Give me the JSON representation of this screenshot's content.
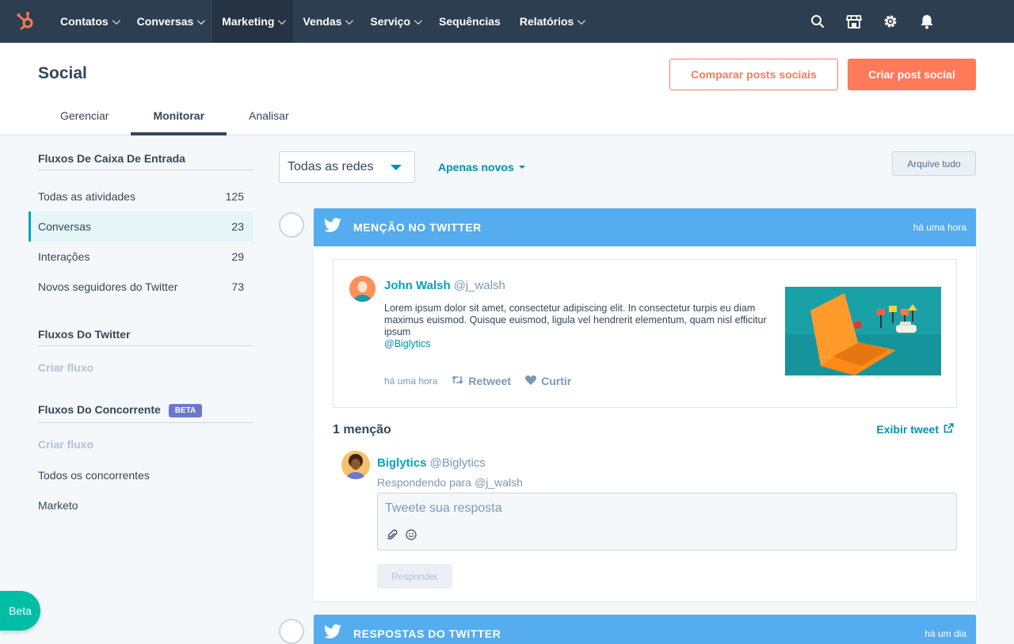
{
  "nav": {
    "items": [
      {
        "label": "Contatos",
        "caret": true
      },
      {
        "label": "Conversas",
        "caret": true
      },
      {
        "label": "Marketing",
        "caret": true,
        "active": true
      },
      {
        "label": "Vendas",
        "caret": true
      },
      {
        "label": "Serviço",
        "caret": true
      },
      {
        "label": "Sequências",
        "caret": false
      },
      {
        "label": "Relatórios",
        "caret": true
      }
    ],
    "icons": [
      "search-icon",
      "marketplace-icon",
      "gear-icon",
      "bell-icon"
    ]
  },
  "header": {
    "title": "Social",
    "compare_button": "Comparar posts sociais",
    "create_button": "Criar post social",
    "tabs": [
      "Gerenciar",
      "Monitorar",
      "Analisar"
    ],
    "active_tab": "Monitorar"
  },
  "sidebar": {
    "inbox_title": "Fluxos De Caixa De Entrada",
    "inbox_items": [
      {
        "label": "Todas as atividades",
        "count": "125"
      },
      {
        "label": "Conversas",
        "count": "23"
      },
      {
        "label": "Interações",
        "count": "29"
      },
      {
        "label": "Novos seguidores do Twitter",
        "count": "73"
      }
    ],
    "twitter_title": "Fluxos Do Twitter",
    "twitter_create": "Criar fluxo",
    "competitor_title": "Fluxos Do Concorrente",
    "competitor_badge": "BETA",
    "competitor_create": "Criar fluxo",
    "competitor_items": [
      "Todos os concorrentes",
      "Marketo"
    ]
  },
  "filters": {
    "network_select": "Todas as redes",
    "only_new": "Apenas novos",
    "archive_all": "Arquive tudo"
  },
  "stream1": {
    "title": "MENÇÃO NO TWITTER",
    "time": "há uma hora",
    "tweet": {
      "name": "John Walsh",
      "handle": "@j_walsh",
      "text": "Lorem ipsum dolor sit amet, consectetur adipiscing elit. In consectetur turpis eu diam maximus euismod. Quisque euismod, ligula vel hendrerit elementum, quam nisl efficitur ipsum",
      "mention": "@Biglytics",
      "time": "há uma hora",
      "retweet": "Retweet",
      "like": "Curtir"
    },
    "mention_count": "1 menção",
    "view_tweet": "Exibir tweet",
    "reply": {
      "name": "Biglytics",
      "handle": "@Biglytics",
      "replying_to": "Respondendo para @j_walsh",
      "placeholder": "Tweete sua resposta",
      "button": "Responder"
    }
  },
  "stream2": {
    "title": "RESPOSTAS DO TWITTER",
    "time": "há um dia"
  },
  "beta_button": "Beta",
  "colors": {
    "nav_bg": "#2d3e50",
    "accent": "#ff7a59",
    "link": "#0091ae",
    "twitter": "#55acee"
  }
}
